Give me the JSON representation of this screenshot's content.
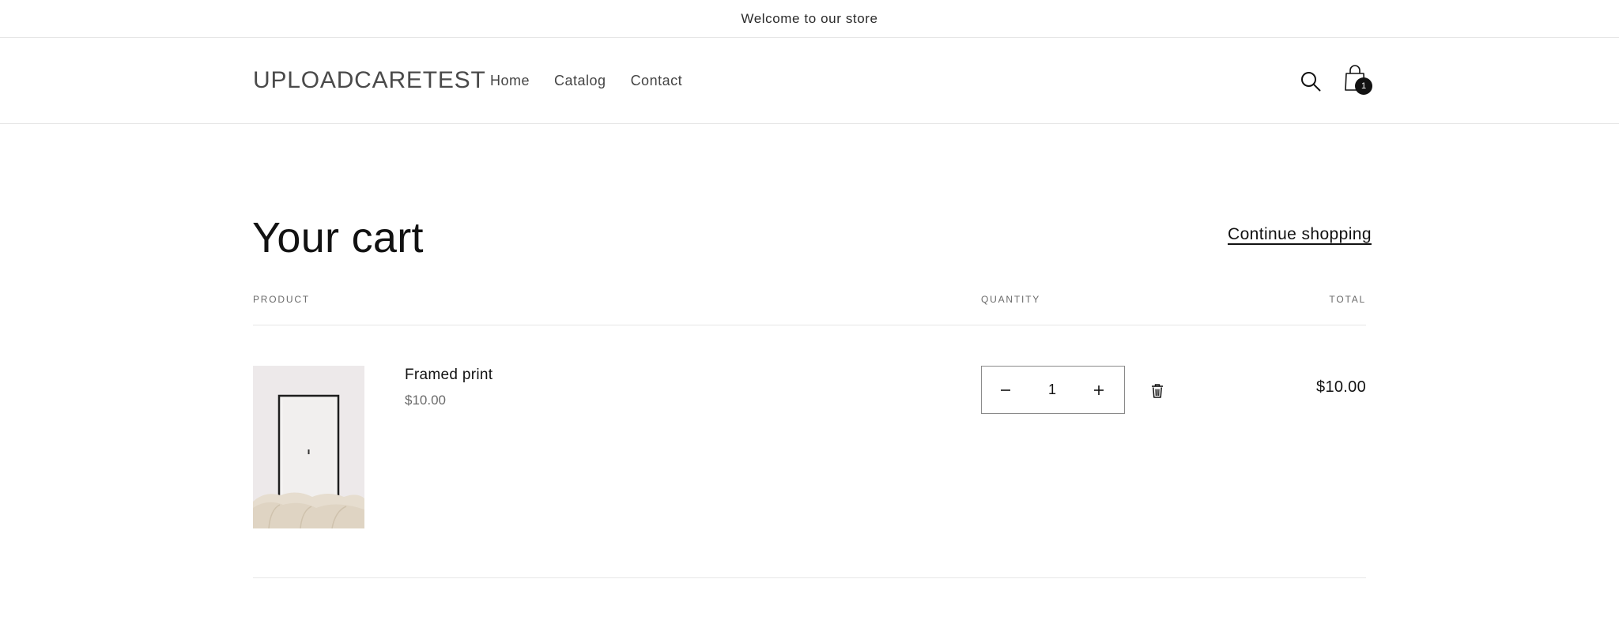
{
  "announcement": {
    "text": "Welcome to our store"
  },
  "header": {
    "logo": "UPLOADCARETEST",
    "nav": [
      {
        "label": "Home"
      },
      {
        "label": "Catalog"
      },
      {
        "label": "Contact"
      }
    ],
    "search_icon": "search-icon",
    "cart_icon": "shopping-bag-icon",
    "cart_count": "1"
  },
  "cart": {
    "title": "Your cart",
    "continue_label": "Continue shopping",
    "columns": {
      "product": "PRODUCT",
      "quantity": "QUANTITY",
      "total": "TOTAL"
    },
    "items": [
      {
        "name": "Framed print",
        "price": "$10.00",
        "quantity": "1",
        "total": "$10.00",
        "image_icon": "framed-print-image",
        "remove_icon": "trash-icon",
        "decrease_icon": "minus-icon",
        "increase_icon": "plus-icon"
      }
    ]
  },
  "colors": {
    "text": "#121212",
    "muted": "#6b6b6b",
    "border": "#e6e6e6",
    "badge": "#121212"
  }
}
